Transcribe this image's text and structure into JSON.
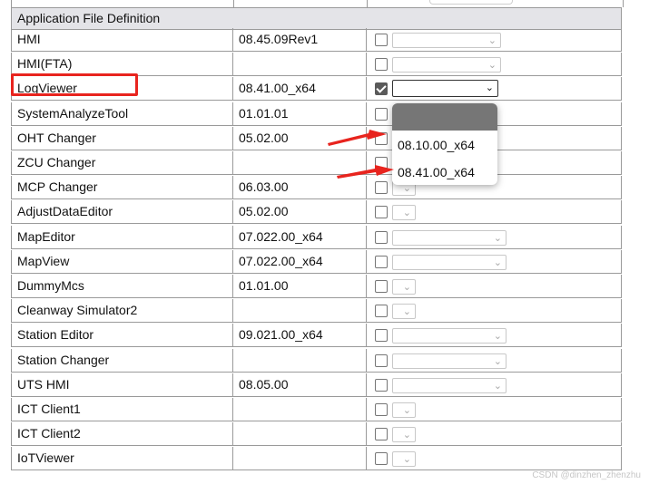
{
  "table": {
    "section_header": "Application File Definition",
    "rows": [
      {
        "name": "HMI",
        "version": "08.45.09Rev1",
        "checked": false,
        "select": "wide"
      },
      {
        "name": "HMI(FTA)",
        "version": "",
        "checked": false,
        "select": "wide"
      },
      {
        "name": "LogViewer",
        "version": "08.41.00_x64",
        "checked": true,
        "select": "active"
      },
      {
        "name": "SystemAnalyzeTool",
        "version": "01.01.01",
        "checked": false,
        "select": "none"
      },
      {
        "name": "OHT Changer",
        "version": "05.02.00",
        "checked": false,
        "select": "none"
      },
      {
        "name": "ZCU Changer",
        "version": "",
        "checked": false,
        "select": "none"
      },
      {
        "name": "MCP Changer",
        "version": "06.03.00",
        "checked": false,
        "select": "short"
      },
      {
        "name": "AdjustDataEditor",
        "version": "05.02.00",
        "checked": false,
        "select": "short"
      },
      {
        "name": "MapEditor",
        "version": "07.022.00_x64",
        "checked": false,
        "select": "wider"
      },
      {
        "name": "MapView",
        "version": "07.022.00_x64",
        "checked": false,
        "select": "wider"
      },
      {
        "name": "DummyMcs",
        "version": "01.01.00",
        "checked": false,
        "select": "short"
      },
      {
        "name": "Cleanway Simulator2",
        "version": "",
        "checked": false,
        "select": "short"
      },
      {
        "name": "Station Editor",
        "version": "09.021.00_x64",
        "checked": false,
        "select": "wider"
      },
      {
        "name": "Station Changer",
        "version": "",
        "checked": false,
        "select": "wider"
      },
      {
        "name": "UTS HMI",
        "version": "08.05.00",
        "checked": false,
        "select": "wider"
      },
      {
        "name": "ICT Client1",
        "version": "",
        "checked": false,
        "select": "short"
      },
      {
        "name": "ICT Client2",
        "version": "",
        "checked": false,
        "select": "short"
      },
      {
        "name": "IoTViewer",
        "version": "",
        "checked": false,
        "select": "short"
      }
    ]
  },
  "dropdown": {
    "options": [
      "08.10.00_x64",
      "08.41.00_x64"
    ]
  },
  "annotations": {
    "highlight_color": "#e8241e"
  },
  "watermark": "CSDN @dinzhen_zhenzhu"
}
